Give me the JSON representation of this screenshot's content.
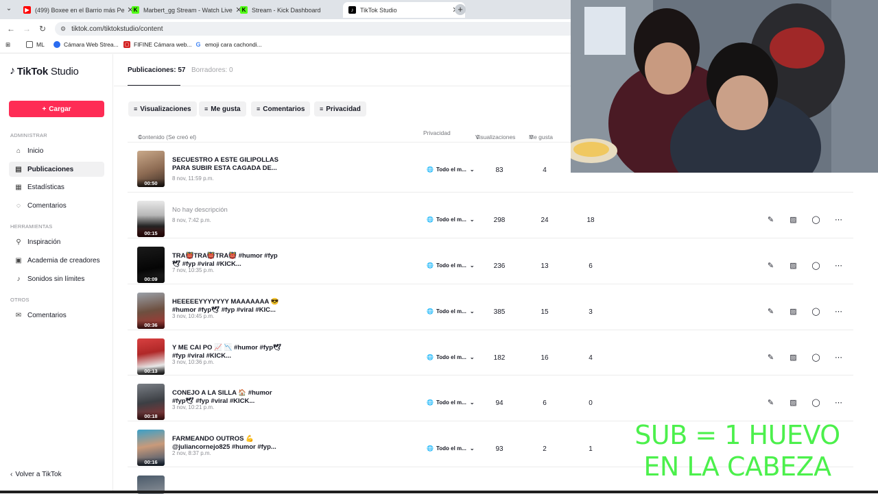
{
  "browser": {
    "tabs": [
      {
        "title": "(499) Boxee en el Barrio más Pe",
        "favicon": "youtube",
        "active": false
      },
      {
        "title": "Marbert_gg Stream - Watch Live",
        "favicon": "kick",
        "active": false
      },
      {
        "title": "Stream - Kick Dashboard",
        "favicon": "kick",
        "active": false
      },
      {
        "title": "TikTok Studio",
        "favicon": "tiktok",
        "active": true
      }
    ],
    "url": "tiktok.com/tiktokstudio/content",
    "bookmarks": [
      "ML",
      "Cámara Web Strea...",
      "FIFINE Cámara web...",
      "emoji cara cachondi..."
    ]
  },
  "sidebar": {
    "logo": "TikTok",
    "logo_suffix": "Studio",
    "upload_label": "Cargar",
    "sections": {
      "admin": "ADMINISTRAR",
      "tools": "HERRAMIENTAS",
      "others": "OTROS"
    },
    "items": [
      {
        "label": "Inicio",
        "icon": "home-icon"
      },
      {
        "label": "Publicaciones",
        "icon": "posts-icon",
        "active": true
      },
      {
        "label": "Estadísticas",
        "icon": "analytics-icon"
      },
      {
        "label": "Comentarios",
        "icon": "comments-icon"
      },
      {
        "label": "Inspiración",
        "icon": "lightbulb-icon"
      },
      {
        "label": "Academia de creadores",
        "icon": "academy-icon"
      },
      {
        "label": "Sonidos sin límites",
        "icon": "music-icon"
      },
      {
        "label": "Comentarios",
        "icon": "feedback-icon"
      }
    ],
    "back_label": "Volver a TikTok"
  },
  "main": {
    "tabs": [
      {
        "label": "Publicaciones: 57",
        "active": true
      },
      {
        "label": "Borradores: 0",
        "active": false
      }
    ],
    "filters": [
      "Visualizaciones",
      "Me gusta",
      "Comentarios",
      "Privacidad"
    ],
    "columns": {
      "content": "Contenido (Se creó el)",
      "privacy": "Privacidad",
      "views": "Visualizaciones",
      "likes": "Me gusta"
    },
    "rows": [
      {
        "title": "SECUESTRO A ESTE GILIPOLLAS PARA SUBIR ESTA CAGADA DE...",
        "date": "8 nov, 11:59 p.m.",
        "duration": "00:50",
        "privacy": "Todo el m...",
        "views": "83",
        "likes": "4",
        "comments": ""
      },
      {
        "title": "No hay descripción",
        "date": "8 nov, 7:42 p.m.",
        "duration": "00:15",
        "privacy": "Todo el m...",
        "views": "298",
        "likes": "24",
        "comments": "18",
        "muted": true
      },
      {
        "title": "TRA👹TRA👹TRA👹 #humor #fyp🕊 #fyp #viral #KICK...",
        "date": "7 nov, 10:35 p.m.",
        "duration": "00:09",
        "privacy": "Todo el m...",
        "views": "236",
        "likes": "13",
        "comments": "6"
      },
      {
        "title": "HEEEEEYYYYYYY MAAAAAAA 😎 #humor #fyp🕊 #fyp #viral #KIC...",
        "date": "3 nov, 10:45 p.m.",
        "duration": "00:36",
        "privacy": "Todo el m...",
        "views": "385",
        "likes": "15",
        "comments": "3"
      },
      {
        "title": "Y ME CAI PO 📈 📉 #humor #fyp🕊 #fyp #viral #KICK...",
        "date": "3 nov, 10:36 p.m.",
        "duration": "00:13",
        "privacy": "Todo el m...",
        "views": "182",
        "likes": "16",
        "comments": "4"
      },
      {
        "title": "CONEJO A LA SILLA 🏠 #humor #fyp🕊 #fyp #viral #KICK...",
        "date": "3 nov, 10:21 p.m.",
        "duration": "00:18",
        "privacy": "Todo el m...",
        "views": "94",
        "likes": "6",
        "comments": "0"
      },
      {
        "title": "FARMEANDO OUTROS 💪 @juliancornejo825 #humor #fyp...",
        "date": "2 nov, 8:37 p.m.",
        "duration": "00:16",
        "privacy": "Todo el m...",
        "views": "93",
        "likes": "2",
        "comments": "1"
      }
    ]
  },
  "overlay": {
    "line1": "SUB = 1 HUEVO",
    "line2": "EN LA CABEZA",
    "color": "#4cf04c"
  },
  "colors": {
    "accent": "#fe2c55",
    "text": "#161823",
    "muted": "#8a8b91"
  }
}
